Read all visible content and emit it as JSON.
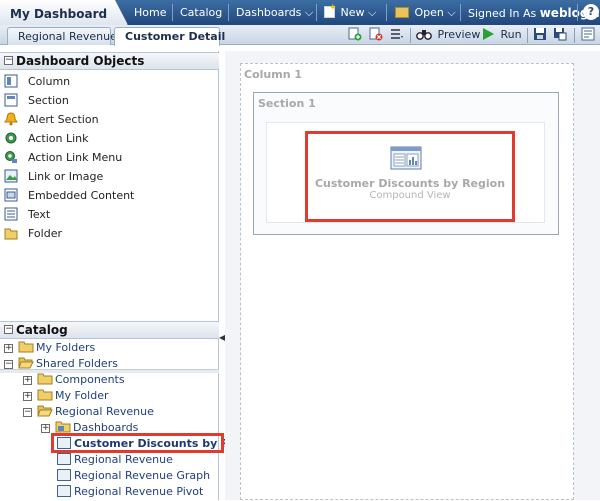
{
  "header": {
    "dashboard_tab": "My Dashboard",
    "nav": {
      "home": "Home",
      "catalog": "Catalog",
      "dashboards": "Dashboards",
      "new": "New",
      "open": "Open",
      "signed_in_as": "Signed In As",
      "user": "weblogic"
    },
    "help": "?"
  },
  "page_tabs": [
    "Regional Revenue",
    "Customer Detail"
  ],
  "toolbar": {
    "preview": "Preview",
    "run": "Run"
  },
  "dashboard_objects": {
    "title": "Dashboard Objects",
    "items": [
      "Column",
      "Section",
      "Alert Section",
      "Action Link",
      "Action Link Menu",
      "Link or Image",
      "Embedded Content",
      "Text",
      "Folder"
    ]
  },
  "catalog": {
    "title": "Catalog",
    "tree": [
      {
        "label": "My Folders",
        "level": 0
      },
      {
        "label": "Shared Folders",
        "level": 0
      },
      {
        "label": "Components",
        "level": 1
      },
      {
        "label": "My Folder",
        "level": 1
      },
      {
        "label": "Regional Revenue",
        "level": 1
      },
      {
        "label": "Dashboards",
        "level": 2
      },
      {
        "label": "Customer Discounts by Re",
        "level": 2
      },
      {
        "label": "Regional Revenue",
        "level": 2
      },
      {
        "label": "Regional Revenue Graph",
        "level": 2
      },
      {
        "label": "Regional Revenue Pivot",
        "level": 2
      }
    ]
  },
  "canvas": {
    "column_label": "Column 1",
    "section_label": "Section 1",
    "view_title": "Customer Discounts by Region",
    "view_subtitle": "Compound View"
  },
  "colors": {
    "header_blue": "#21477c",
    "highlight_red": "#e23b2e"
  }
}
